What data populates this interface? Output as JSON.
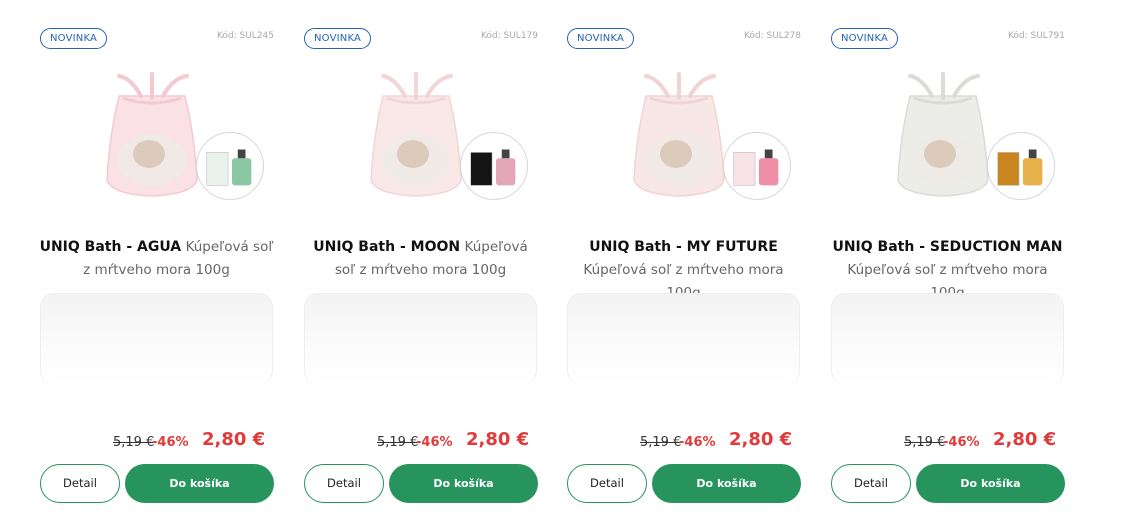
{
  "products": [
    {
      "badge": "NOVINKA",
      "code": "Kód: SUL245",
      "name": "UNIQ Bath - AGUA",
      "description": "Kúpeľová soľ z mŕtveho mora 100g",
      "old_price": "5,19 €",
      "discount": "-46%",
      "price": "2,80 €",
      "detail_label": "Detail",
      "cart_label": "Do košíka",
      "bag_color": "#f4c9d2",
      "perfume_colors": [
        "#e9f3ec",
        "#8cc7a3"
      ]
    },
    {
      "badge": "NOVINKA",
      "code": "Kód: SUL179",
      "name": "UNIQ Bath - MOON",
      "description": "Kúpeľová soľ z mŕtveho mora 100g",
      "old_price": "5,19 €",
      "discount": "-46%",
      "price": "2,80 €",
      "detail_label": "Detail",
      "cart_label": "Do košíka",
      "bag_color": "#f2d5d6",
      "perfume_colors": [
        "#141414",
        "#e3a6b8"
      ]
    },
    {
      "badge": "NOVINKA",
      "code": "Kód: SUL278",
      "name": "UNIQ Bath - MY FUTURE",
      "description": "Kúpeľová soľ z mŕtveho mora 100g",
      "old_price": "5,19 €",
      "discount": "-46%",
      "price": "2,80 €",
      "detail_label": "Detail",
      "cart_label": "Do košíka",
      "bag_color": "#f2d3d3",
      "perfume_colors": [
        "#f7e3e7",
        "#ef8fa5"
      ]
    },
    {
      "badge": "NOVINKA",
      "code": "Kód: SUL791",
      "name": "UNIQ Bath - SEDUCTION MAN",
      "description": "Kúpeľová soľ z mŕtveho mora 100g",
      "old_price": "5,19 €",
      "discount": "-46%",
      "price": "2,80 €",
      "detail_label": "Detail",
      "cart_label": "Do košíka",
      "bag_color": "#dcdcd6",
      "perfume_colors": [
        "#c9861f",
        "#e7b04a"
      ]
    }
  ],
  "colors": {
    "badge": "#2463b3",
    "accent_green": "#27935d",
    "price_red": "#e23a3a"
  }
}
